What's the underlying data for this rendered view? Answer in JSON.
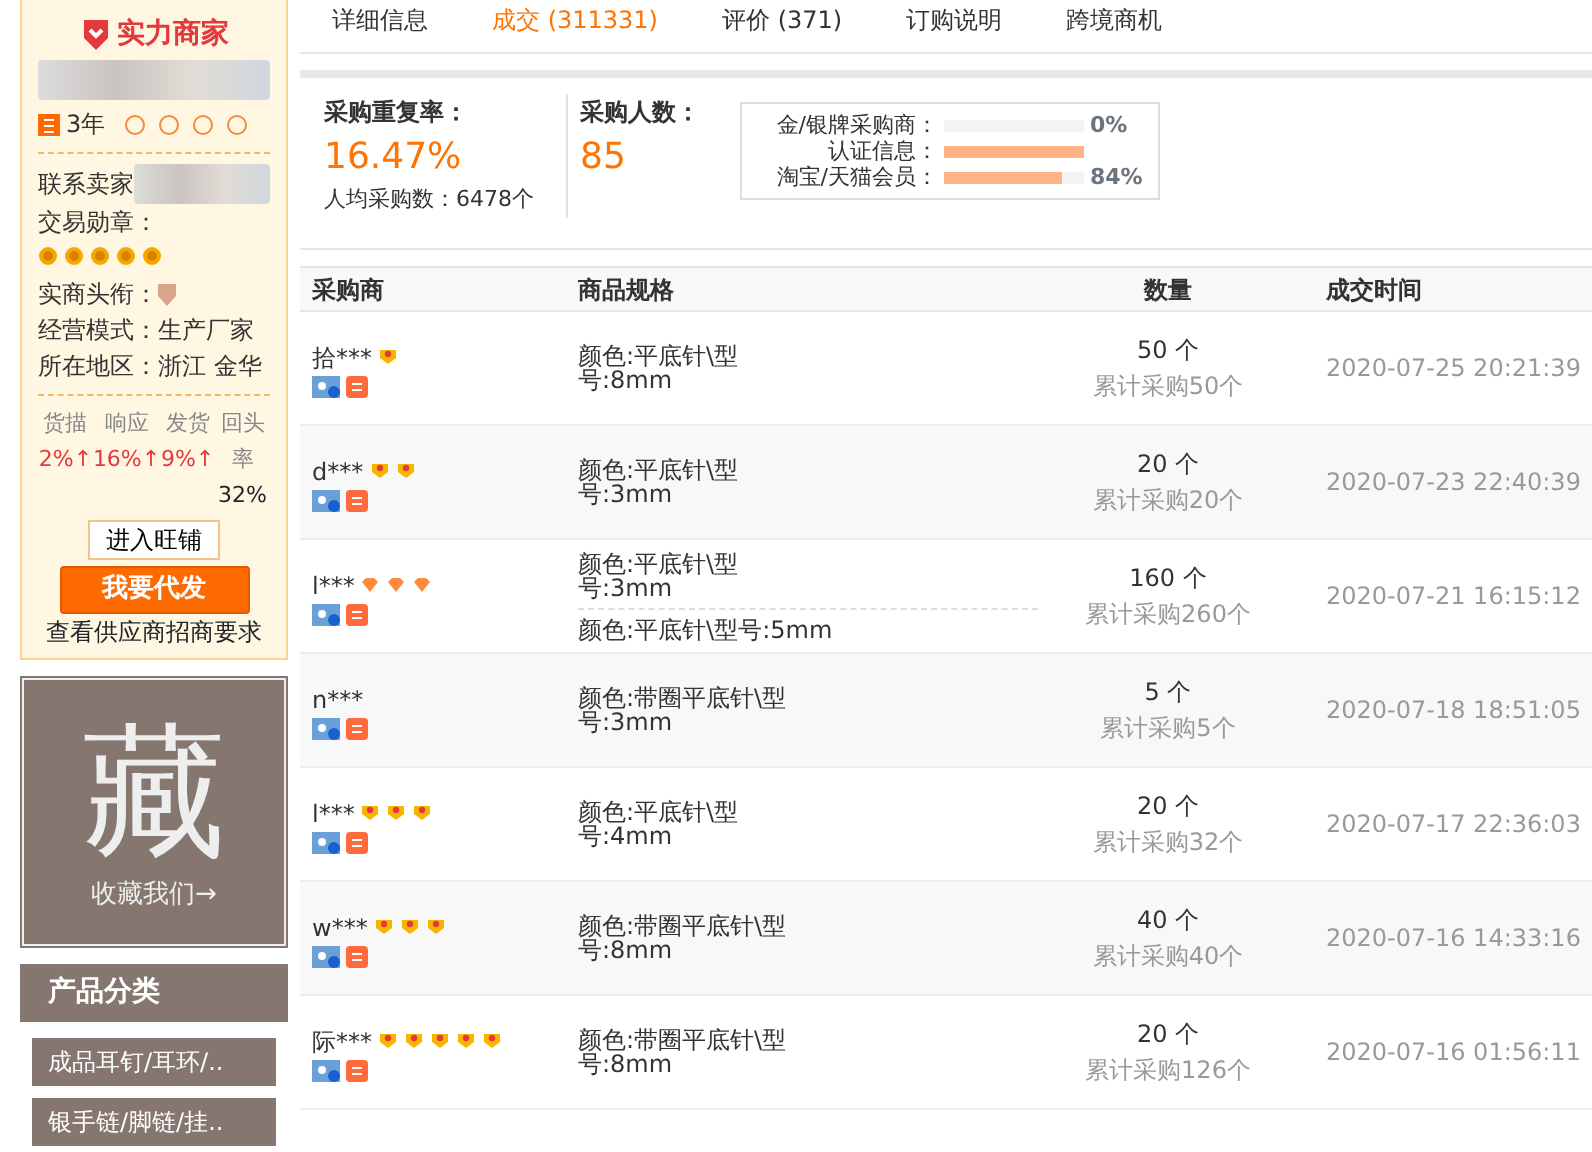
{
  "sidebar": {
    "brand": "实力商家",
    "years": "3年",
    "contact_label": "联系卖家",
    "medals_label": "交易勋章：",
    "medals": [
      {
        "kind": "coin"
      },
      {
        "kind": "coin"
      },
      {
        "kind": "coin"
      },
      {
        "kind": "coin"
      },
      {
        "kind": "coin"
      }
    ],
    "title_label": "实商头衔：",
    "mode_label": "经营模式：",
    "mode": "生产厂家",
    "region_label": "所在地区：",
    "region": "浙江 金华",
    "scores": [
      {
        "label": "货描",
        "value": "2%",
        "arrow": "↑"
      },
      {
        "label": "响应",
        "value": "16%",
        "arrow": "↑"
      },
      {
        "label": "发货",
        "value": "9%",
        "arrow": "↑"
      },
      {
        "label": "回头率",
        "value": "32%"
      }
    ],
    "shop_button": "进入旺铺",
    "dropship_button": "我要代发",
    "requirements_link": "查看供应商招商要求",
    "favorite": {
      "glyph": "藏",
      "caption": "收藏我们→"
    },
    "category_title": "产品分类",
    "categories": [
      "成品耳钉/耳环/..",
      "银手链/脚链/挂.."
    ]
  },
  "tabs": [
    {
      "label": "详细信息",
      "selected": false
    },
    {
      "label": "成交 (311331)",
      "selected": true
    },
    {
      "label": "评价 (371)",
      "selected": false
    },
    {
      "label": "订购说明",
      "selected": false
    },
    {
      "label": "跨境商机",
      "selected": false
    }
  ],
  "summary": {
    "repeat_label": "采购重复率：",
    "repeat_value": "16.47%",
    "average": "人均采购数：6478个",
    "buyers_label": "采购人数：",
    "buyers_value": "85",
    "meters": [
      {
        "label": "金/银牌采购商：",
        "level": 0,
        "reading": "0%"
      },
      {
        "label": "认证信息：",
        "level": 1
      },
      {
        "label": "淘宝/天猫会员：",
        "level": 0.84,
        "reading": "84%"
      }
    ]
  },
  "table": {
    "columns": [
      "采购商",
      "商品规格",
      "数量",
      "成交时间"
    ],
    "rows": [
      {
        "buyer": "拾***",
        "medals": [
          {
            "kind": "crown"
          }
        ],
        "specs": [
          "颜色:平底针\\型号:8mm"
        ],
        "quantity": "50 个",
        "total": "累计采购50个",
        "time": "2020-07-25 20:21:39"
      },
      {
        "buyer": "d***",
        "medals": [
          {
            "kind": "crown"
          },
          {
            "kind": "crown"
          }
        ],
        "specs": [
          "颜色:平底针\\型号:3mm"
        ],
        "quantity": "20 个",
        "total": "累计采购20个",
        "time": "2020-07-23 22:40:39"
      },
      {
        "buyer": "l***",
        "medals": [
          {
            "kind": "diamond"
          },
          {
            "kind": "diamond"
          },
          {
            "kind": "diamond"
          }
        ],
        "specs": [
          "颜色:平底针\\型号:3mm",
          "颜色:平底针\\型号:5mm"
        ],
        "quantity": "160 个",
        "total": "累计采购260个",
        "time": "2020-07-21 16:15:12"
      },
      {
        "buyer": "n***",
        "specs": [
          "颜色:带圈平底针\\型号:3mm"
        ],
        "quantity": "5 个",
        "total": "累计采购5个",
        "time": "2020-07-18 18:51:05"
      },
      {
        "buyer": "l***",
        "medals": [
          {
            "kind": "crown"
          },
          {
            "kind": "crown"
          },
          {
            "kind": "crown"
          }
        ],
        "specs": [
          "颜色:平底针\\型号:4mm"
        ],
        "quantity": "20 个",
        "total": "累计采购32个",
        "time": "2020-07-17 22:36:03"
      },
      {
        "buyer": "w***",
        "medals": [
          {
            "kind": "crown"
          },
          {
            "kind": "crown"
          },
          {
            "kind": "crown"
          }
        ],
        "specs": [
          "颜色:带圈平底针\\型号:8mm"
        ],
        "quantity": "40 个",
        "total": "累计采购40个",
        "time": "2020-07-16 14:33:16"
      },
      {
        "buyer": "际***",
        "medals": [
          {
            "kind": "crown"
          },
          {
            "kind": "crown"
          },
          {
            "kind": "crown"
          },
          {
            "kind": "crown"
          },
          {
            "kind": "crown"
          }
        ],
        "specs": [
          "颜色:带圈平底针\\型号:8mm"
        ],
        "quantity": "20 个",
        "total": "累计采购126个",
        "time": "2020-07-16 01:56:11"
      }
    ]
  }
}
